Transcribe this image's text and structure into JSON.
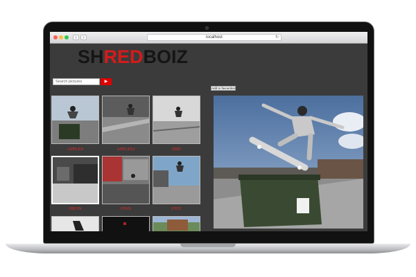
{
  "browser": {
    "url": "localhost",
    "back_glyph": "‹",
    "forward_glyph": "›",
    "reload_glyph": "↻"
  },
  "logo": {
    "part1": "SH",
    "part2": "RED",
    "part3": "BOIZ"
  },
  "search": {
    "placeholder": "Search pictures",
    "button_glyph": "▶"
  },
  "favourites_button": "Add to favourites",
  "thumbnails": [
    {
      "caption": "APPLES"
    },
    {
      "caption": "APPLES2"
    },
    {
      "caption": "DRE"
    },
    {
      "caption": "DEON"
    },
    {
      "caption": "FINN"
    },
    {
      "caption": "FITZ"
    }
  ],
  "colors": {
    "accent": "#e00000",
    "caption": "#e52c2c",
    "background": "#3b3b3b"
  }
}
